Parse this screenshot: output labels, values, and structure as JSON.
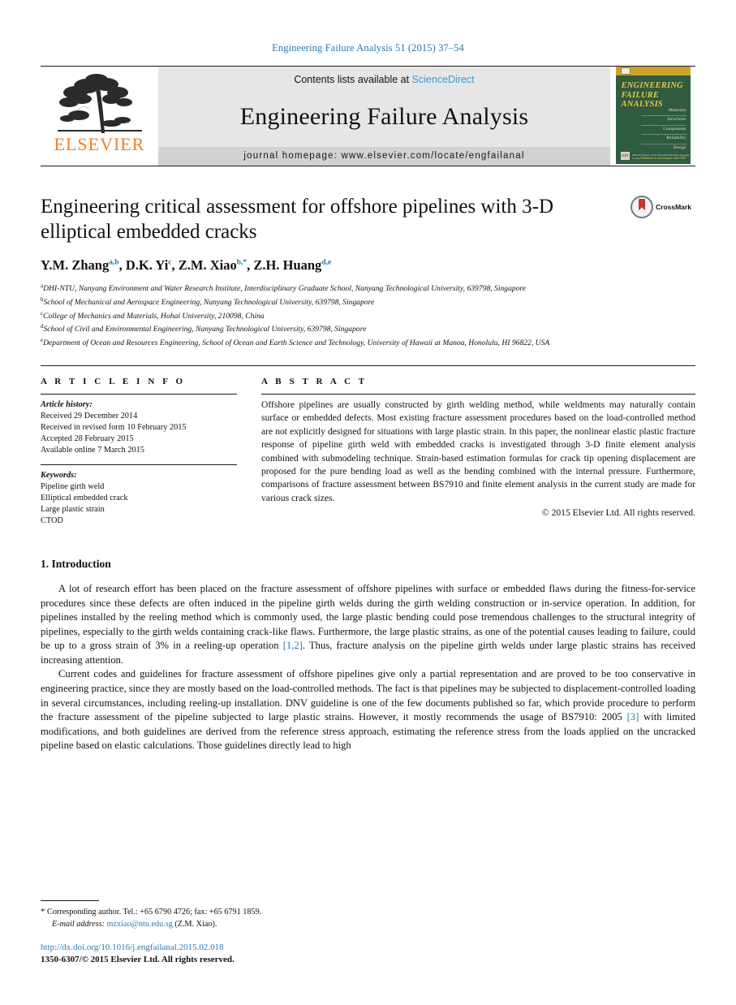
{
  "running_head": "Engineering Failure Analysis 51 (2015) 37–54",
  "masthead": {
    "publisher_name": "ELSEVIER",
    "contents_prefix": "Contents lists available at ",
    "contents_link": "ScienceDirect",
    "journal_title": "Engineering Failure Analysis",
    "homepage": "journal homepage: www.elsevier.com/locate/engfailanal",
    "cover": {
      "title_line1": "ENGINEERING",
      "title_line2": "FAILURE",
      "title_line3": "ANALYSIS",
      "keywords": [
        "Materials",
        "Structures",
        "Components",
        "Reliability",
        "Design"
      ],
      "logo_text": "EIS",
      "foot_text": "Official Journal of the European Structural Integrity Society",
      "right_label": "Published in association with ESIS"
    }
  },
  "article": {
    "title": "Engineering critical assessment for offshore pipelines with 3-D elliptical embedded cracks",
    "crossmark_label": "CrossMark",
    "authors": [
      {
        "name": "Y.M. Zhang",
        "marks": "a,b",
        "sep": ", "
      },
      {
        "name": "D.K. Yi",
        "marks": "c",
        "sep": ", "
      },
      {
        "name": "Z.M. Xiao",
        "marks": "b,*",
        "sep": ", "
      },
      {
        "name": "Z.H. Huang",
        "marks": "d,e",
        "sep": ""
      }
    ],
    "affiliations": [
      {
        "mark": "a",
        "text": "DHI-NTU, Nanyang Environment and Water Research Institute, Interdisciplinary Graduate School, Nanyang Technological University, 639798, Singapore"
      },
      {
        "mark": "b",
        "text": "School of Mechanical and Aerospace Engineering, Nanyang Technological University, 639798, Singapore"
      },
      {
        "mark": "c",
        "text": "College of Mechanics and Materials, Hohai University, 210098, China"
      },
      {
        "mark": "d",
        "text": "School of Civil and Environmental Engineering, Nanyang Technological University, 639798, Singapore"
      },
      {
        "mark": "e",
        "text": "Department of Ocean and Resources Engineering, School of Ocean and Earth Science and Technology, University of Hawaii at Manoa, Honolulu, HI 96822, USA"
      }
    ]
  },
  "article_info": {
    "heading": "A R T I C L E    I N F O",
    "history_label": "Article history:",
    "history": [
      "Received 29 December 2014",
      "Received in revised form 10 February 2015",
      "Accepted 28 February 2015",
      "Available online 7 March 2015"
    ],
    "keywords_label": "Keywords:",
    "keywords": [
      "Pipeline girth weld",
      "Elliptical embedded crack",
      "Large plastic strain",
      "CTOD"
    ]
  },
  "abstract": {
    "heading": "A B S T R A C T",
    "text": "Offshore pipelines are usually constructed by girth welding method, while weldments may naturally contain surface or embedded defects. Most existing fracture assessment procedures based on the load-controlled method are not explicitly designed for situations with large plastic strain. In this paper, the nonlinear elastic plastic fracture response of pipeline girth weld with embedded cracks is investigated through 3-D finite element analysis combined with submodeling technique. Strain-based estimation formulas for crack tip opening displacement are proposed for the pure bending load as well as the bending combined with the internal pressure. Furthermore, comparisons of fracture assessment between BS7910 and finite element analysis in the current study are made for various crack sizes.",
    "copyright": "© 2015 Elsevier Ltd. All rights reserved."
  },
  "body": {
    "section_title": "1. Introduction",
    "paragraph1_part1": "A lot of research effort has been placed on the fracture assessment of offshore pipelines with surface or embedded flaws during the fitness-for-service procedures since these defects are often induced in the pipeline girth welds during the girth welding construction or in-service operation. In addition, for pipelines installed by the reeling method which is commonly used, the large plastic bending could pose tremendous challenges to the structural integrity of pipelines, especially to the girth welds containing crack-like flaws. Furthermore, the large plastic strains, as one of the potential causes leading to failure, could be up to a gross strain of 3% in a reeling-up operation ",
    "paragraph1_ref": "[1,2]",
    "paragraph1_part2": ". Thus, fracture analysis on the pipeline girth welds under large plastic strains has received increasing attention.",
    "paragraph2_part1": "Current codes and guidelines for fracture assessment of offshore pipelines give only a partial representation and are proved to be too conservative in engineering practice, since they are mostly based on the load-controlled methods. The fact is that pipelines may be subjected to displacement-controlled loading in several circumstances, including reeling-up installation. DNV guideline is one of the few documents published so far, which provide procedure to perform the fracture assessment of the pipeline subjected to large plastic strains. However, it mostly recommends the usage of BS7910: 2005 ",
    "paragraph2_ref": "[3]",
    "paragraph2_part2": " with limited modifications, and both guidelines are derived from the reference stress approach, estimating the reference stress from the loads applied on the uncracked pipeline based on elastic calculations. Those guidelines directly lead to high"
  },
  "footer": {
    "corresponding_star": "*",
    "corresponding_text": "Corresponding author. Tel.: +65 6790 4726; fax: +65 6791 1859.",
    "email_label": "E-mail address:",
    "email": "mzxiao@ntu.edu.sg",
    "email_owner": "(Z.M. Xiao).",
    "doi": "http://dx.doi.org/10.1016/j.engfailanal.2015.02.018",
    "issn": "1350-6307/© 2015 Elsevier Ltd. All rights reserved."
  },
  "colors": {
    "link_blue": "#2a7ab0",
    "sciencedirect_blue": "#3a9bd9",
    "elsevier_orange": "#f07e26",
    "cover_green": "#2f5c3f",
    "cover_gold": "#e9c54a"
  }
}
